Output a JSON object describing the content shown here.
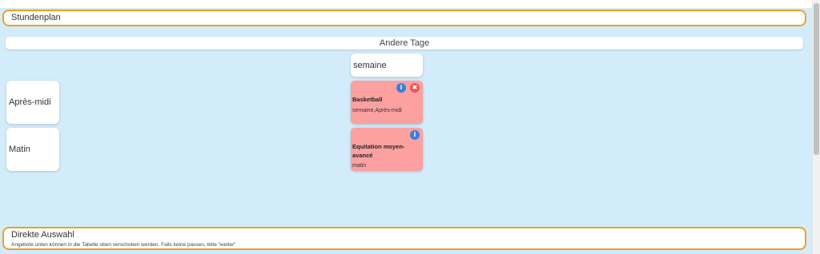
{
  "header": {
    "title": "Stundenplan"
  },
  "tab": {
    "label": "Andere Tage"
  },
  "day": {
    "label": "semaine"
  },
  "slots": [
    {
      "label": "Après-midi"
    },
    {
      "label": "Matin"
    }
  ],
  "activities": [
    {
      "title": "Basketball",
      "meta": "semaine,Après-midi"
    },
    {
      "title": "Equitation moyen-avancé",
      "meta": "matin"
    }
  ],
  "icons": {
    "info": "i",
    "close": "✖"
  },
  "direct": {
    "title": "Direkte Auswahl",
    "description": "Angebote unten können in die Tabelle oben verschoben werden. Falls keine passen, bitte \"weiter\""
  },
  "colors": {
    "background": "#d3ecfb",
    "accent": "#f0a020",
    "activity": "#fca0a0",
    "info": "#3b7de0",
    "close": "#e25b5b"
  }
}
